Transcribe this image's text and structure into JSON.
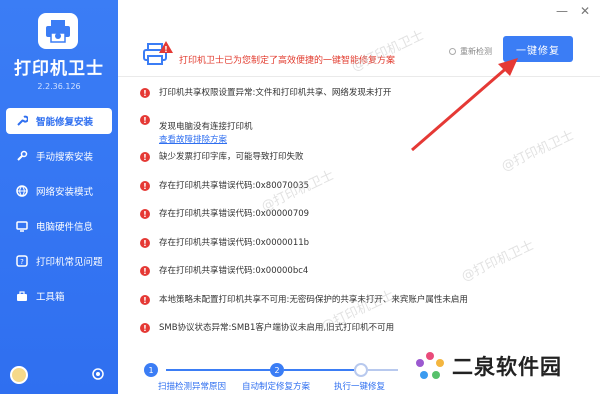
{
  "app": {
    "title": "打印机卫士",
    "version": "2.2.36.126"
  },
  "sidebar": {
    "items": [
      {
        "label": "智能修复安装",
        "icon": "wrench-icon",
        "active": true
      },
      {
        "label": "手动搜索安装",
        "icon": "search-tool-icon",
        "active": false
      },
      {
        "label": "网络安装模式",
        "icon": "network-icon",
        "active": false
      },
      {
        "label": "电脑硬件信息",
        "icon": "hardware-icon",
        "active": false
      },
      {
        "label": "打印机常见问题",
        "icon": "question-icon",
        "active": false
      },
      {
        "label": "工具箱",
        "icon": "toolbox-icon",
        "active": false
      }
    ]
  },
  "header": {
    "message": "打印机卫士已为您制定了高效便捷的一键智能修复方案",
    "recheck_label": "重新检测",
    "fix_button": "一键修复"
  },
  "window": {
    "minimize": "—",
    "close": "✕"
  },
  "issues": [
    {
      "text": "打印机共享权限设置异常:文件和打印机共享、网络发现未打开"
    },
    {
      "text": "发现电脑没有连接打印机",
      "link": "查看故障排除方案"
    },
    {
      "text": "缺少发票打印字库，可能导致打印失败"
    },
    {
      "text": "存在打印机共享错误代码:0x80070035"
    },
    {
      "text": "存在打印机共享错误代码:0x00000709"
    },
    {
      "text": "存在打印机共享错误代码:0x0000011b"
    },
    {
      "text": "存在打印机共享错误代码:0x00000bc4"
    },
    {
      "text": "本地策略未配置打印机共享不可用:无密码保护的共享未打开、来宾账户属性未启用"
    },
    {
      "text": "SMB协议状态异常:SMB1客户端协议未启用,旧式打印机不可用"
    }
  ],
  "watermark": "@打印机卫士",
  "steps": [
    {
      "num": "1",
      "label": "扫描检测异常原因"
    },
    {
      "num": "2",
      "label": "自动制定修复方案"
    },
    {
      "num": "",
      "label": "执行一键修复"
    }
  ],
  "brand": {
    "text": "二泉软件园"
  },
  "colors": {
    "accent": "#3b7df5",
    "error": "#e53935",
    "header_message": "#e23b2e"
  }
}
